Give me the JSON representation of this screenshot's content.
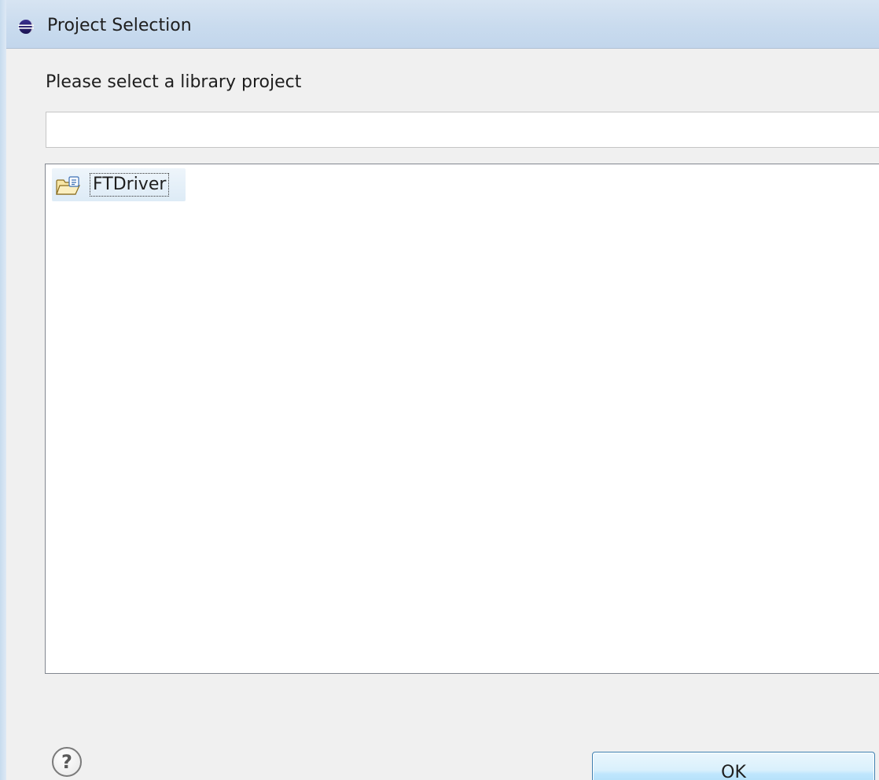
{
  "window": {
    "title": "Project Selection",
    "app_icon": "eclipse-icon"
  },
  "dialog": {
    "prompt": "Please select a library project",
    "filter": {
      "value": "",
      "placeholder": ""
    },
    "projects": [
      {
        "label": "FTDriver",
        "icon": "android-library-project-folder-icon",
        "selected": true
      }
    ]
  },
  "buttons": {
    "help_icon": "question-mark-icon",
    "ok_label": "OK"
  },
  "colors": {
    "titlebar": "#c9dbee",
    "dialog_background": "#f0f0f0",
    "selection": "#ddebf6",
    "button_border": "#3c7fb1"
  }
}
